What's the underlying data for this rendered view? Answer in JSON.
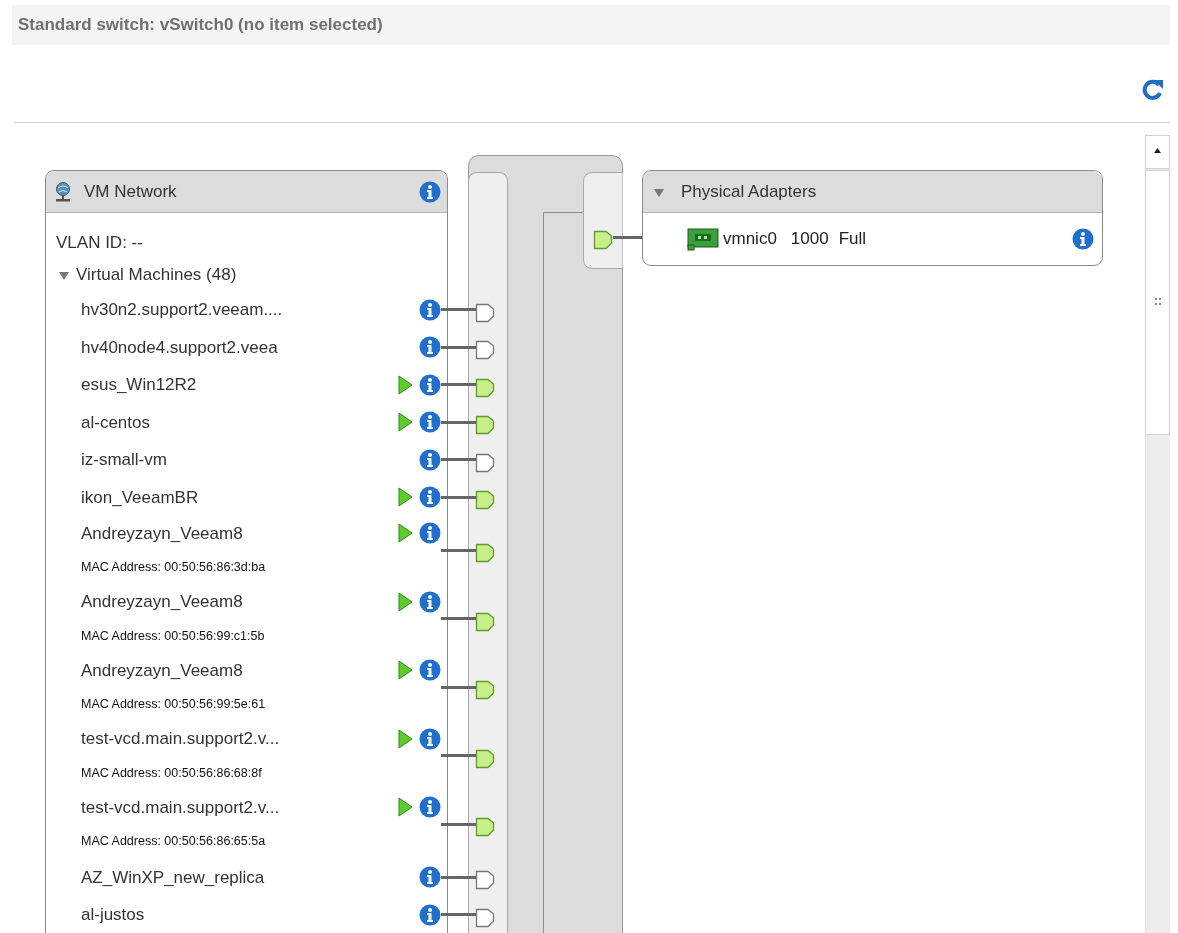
{
  "header": {
    "title": "Standard switch: vSwitch0 (no item selected)"
  },
  "port_group": {
    "name": "VM Network",
    "vlan": "VLAN ID: --",
    "vm_section": {
      "label": "Virtual Machines (48)",
      "expanded": true
    },
    "vms": [
      {
        "name": "hv30n2.support2.veeam....",
        "powered_on": false
      },
      {
        "name": "hv40node4.support2.veea",
        "powered_on": false
      },
      {
        "name": "esus_Win12R2",
        "powered_on": true
      },
      {
        "name": "al-centos",
        "powered_on": true
      },
      {
        "name": "iz-small-vm",
        "powered_on": false
      },
      {
        "name": "ikon_VeeamBR",
        "powered_on": true
      },
      {
        "name": "Andreyzayn_Veeam8",
        "powered_on": true,
        "mac": "MAC Address: 00:50:56:86:3d:ba"
      },
      {
        "name": "Andreyzayn_Veeam8",
        "powered_on": true,
        "mac": "MAC Address: 00:50:56:99:c1:5b"
      },
      {
        "name": "Andreyzayn_Veeam8",
        "powered_on": true,
        "mac": "MAC Address: 00:50:56:99:5e:61"
      },
      {
        "name": "test-vcd.main.support2.v...",
        "powered_on": true,
        "mac": "MAC Address: 00:50:56:86:68:8f"
      },
      {
        "name": "test-vcd.main.support2.v...",
        "powered_on": true,
        "mac": "MAC Address: 00:50:56:86:65:5a"
      },
      {
        "name": "AZ_WinXP_new_replica",
        "powered_on": false
      },
      {
        "name": "al-justos",
        "powered_on": false
      }
    ]
  },
  "physical_adapters": {
    "label": "Physical Adapters",
    "expanded": true,
    "adapters": [
      {
        "name": "vmnic0",
        "speed": "1000",
        "duplex": "Full"
      }
    ]
  }
}
